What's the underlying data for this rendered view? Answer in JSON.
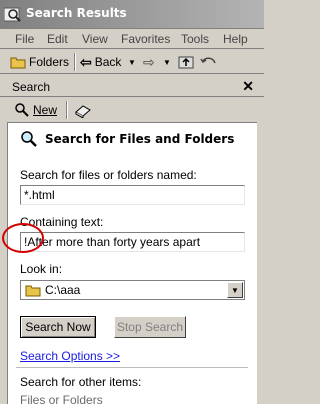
{
  "window": {
    "title": "Search Results"
  },
  "menu": [
    "File",
    "Edit",
    "View",
    "Favorites",
    "Tools",
    "Help"
  ],
  "toolbar": {
    "folders_label": "Folders",
    "back_label": "Back"
  },
  "panel": {
    "title": "Search",
    "new_label": "New"
  },
  "search": {
    "heading": "Search for Files and Folders",
    "named_label": "Search for files or folders named:",
    "named_value": "*.html",
    "containing_label": "Containing text:",
    "containing_value": "!After more than forty years apart",
    "lookin_label": "Look in:",
    "lookin_value": "C:\\aaa",
    "search_now_label": "Search Now",
    "stop_search_label": "Stop Search",
    "options_label": "Search Options >>",
    "other_label": "Search for other items:",
    "files_folders_label": "Files or Folders"
  },
  "colors": {
    "highlight": "#d40000",
    "link": "#1a1ae0",
    "title_gradient_start": "#808080"
  }
}
